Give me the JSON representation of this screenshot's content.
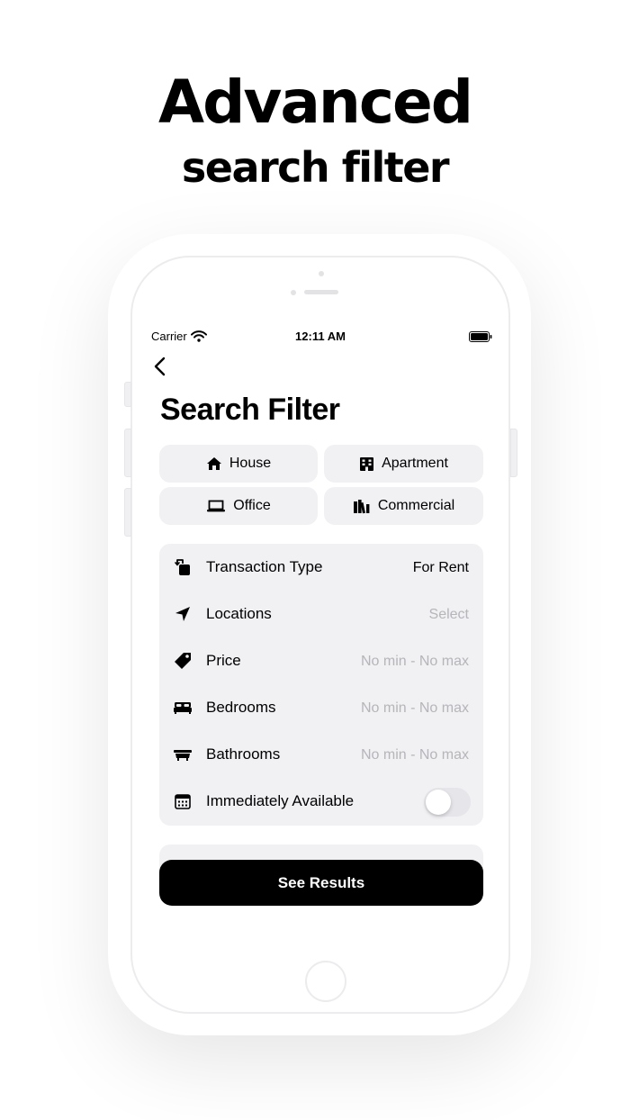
{
  "promo": {
    "title": "Advanced",
    "subtitle": "search filter"
  },
  "status_bar": {
    "carrier": "Carrier",
    "time": "12:11 AM"
  },
  "screen": {
    "title": "Search Filter"
  },
  "property_types": [
    {
      "label": "House",
      "icon": "home-icon"
    },
    {
      "label": "Apartment",
      "icon": "building-icon"
    },
    {
      "label": "Office",
      "icon": "laptop-icon"
    },
    {
      "label": "Commercial",
      "icon": "books-icon"
    }
  ],
  "filters": [
    {
      "label": "Transaction Type",
      "value": "For Rent",
      "icon": "transaction-icon"
    },
    {
      "label": "Locations",
      "value": "Select",
      "icon": "location-arrow-icon"
    },
    {
      "label": "Price",
      "value": "No min - No max",
      "icon": "price-tag-icon"
    },
    {
      "label": "Bedrooms",
      "value": "No min - No max",
      "icon": "bed-icon"
    },
    {
      "label": "Bathrooms",
      "value": "No min - No max",
      "icon": "bathtub-icon"
    },
    {
      "label": "Immediately Available",
      "icon": "calendar-icon",
      "toggle_on": false
    }
  ],
  "cta": {
    "label": "See Results"
  },
  "colors": {
    "accent": "#000000",
    "panel": "#f1f1f4",
    "placeholder": "#b5b5ba"
  }
}
